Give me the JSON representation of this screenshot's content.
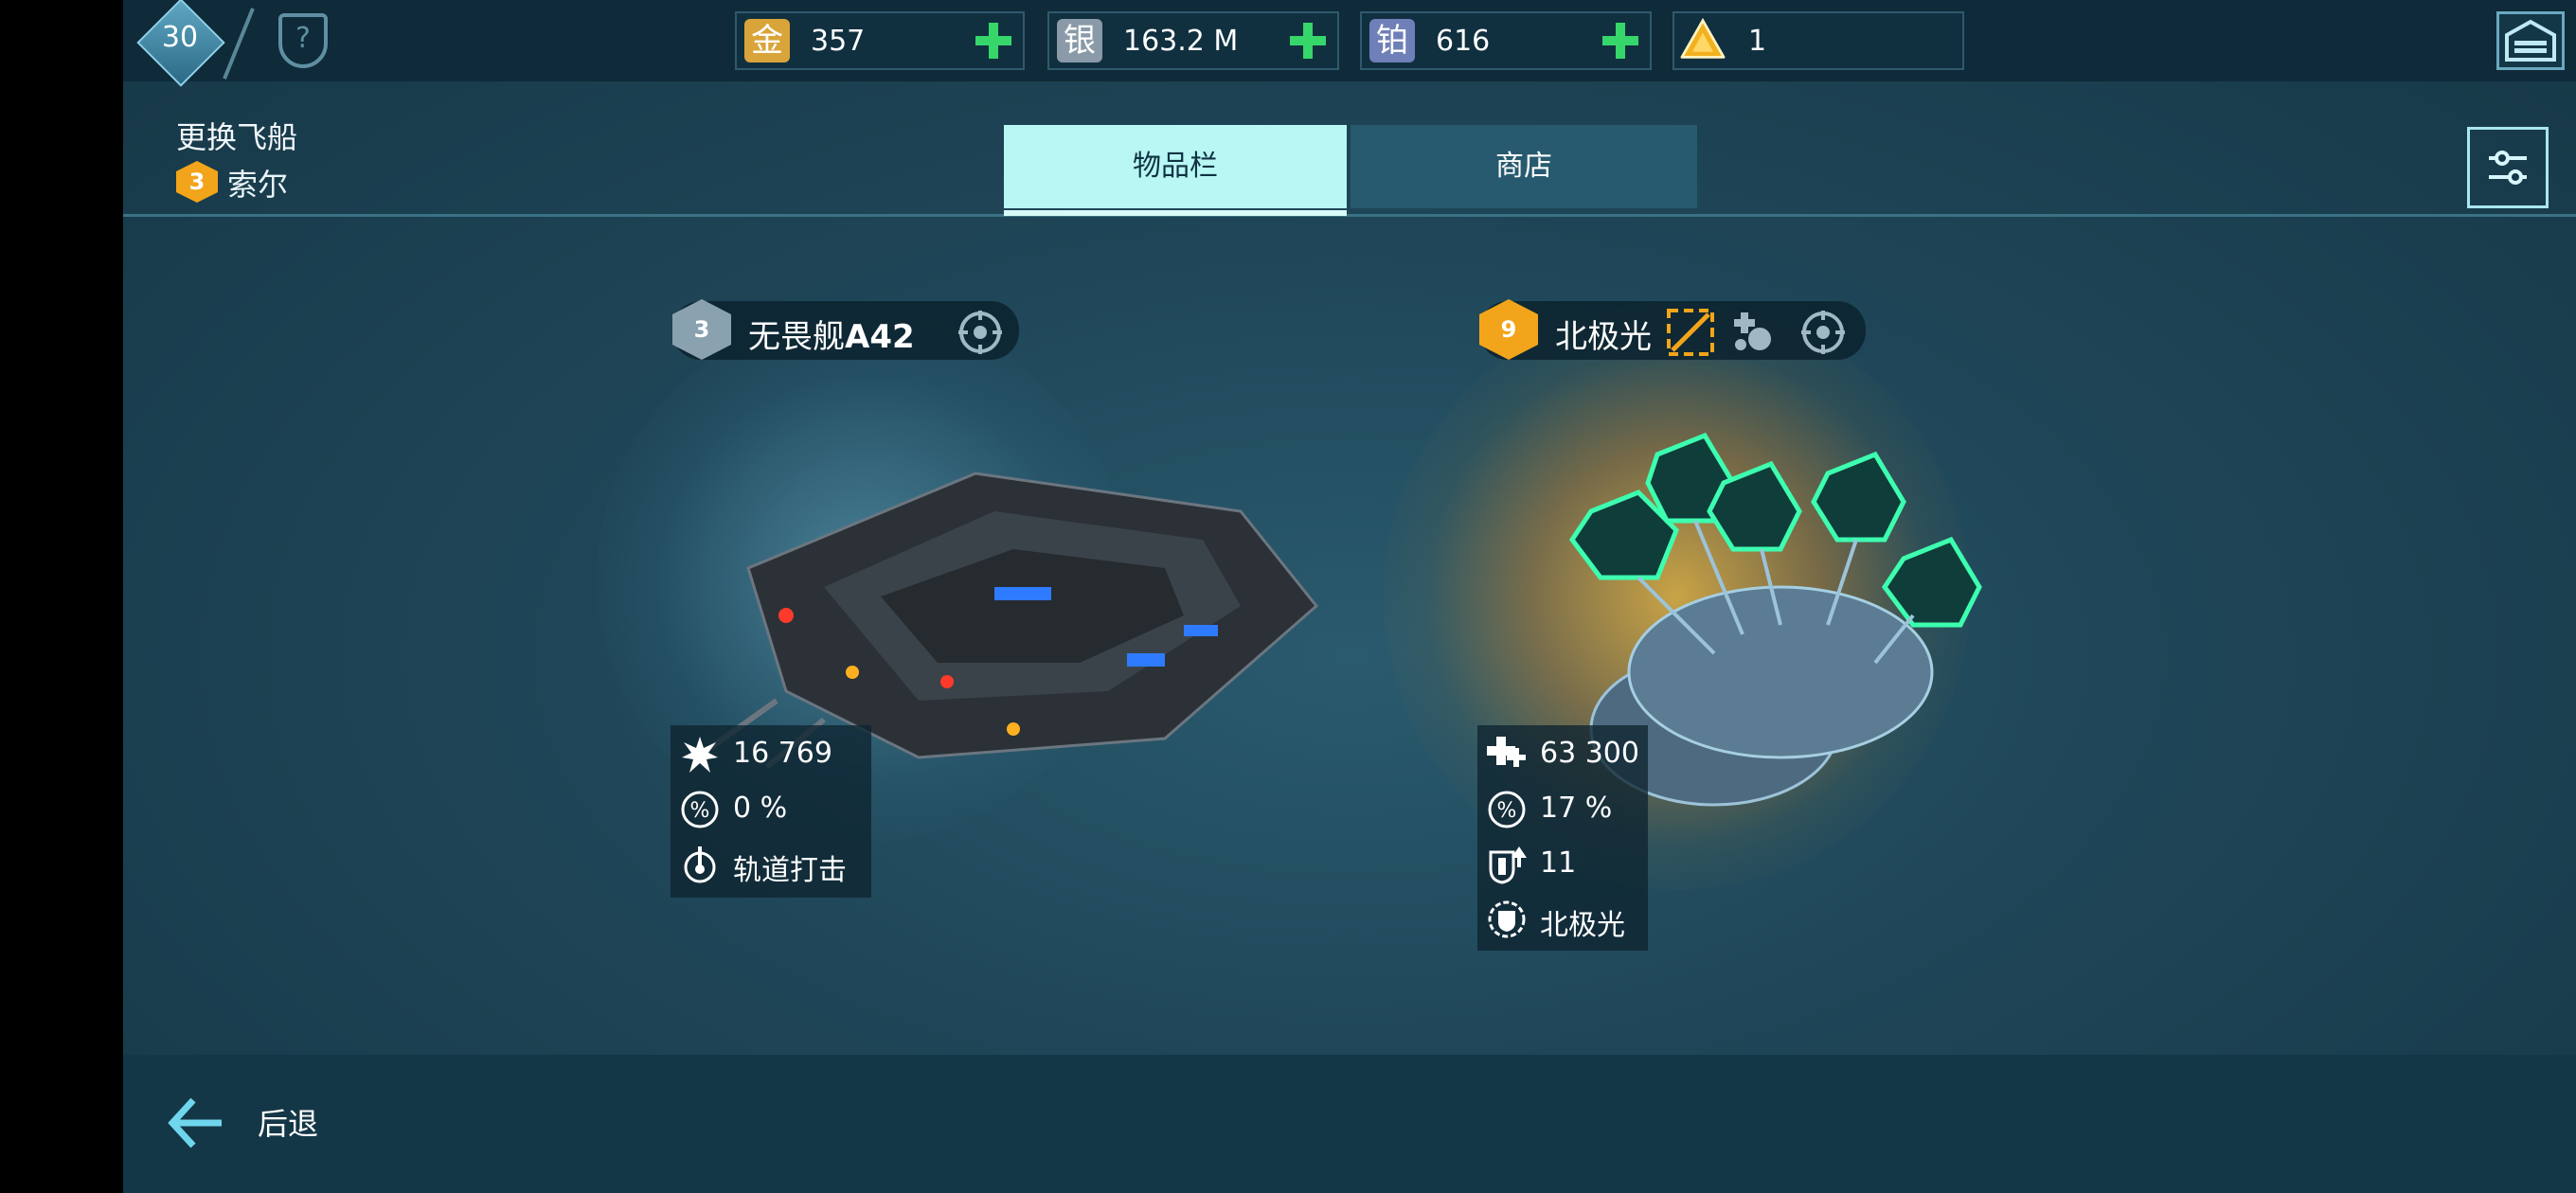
{
  "topbar": {
    "level": "30",
    "resources": [
      {
        "icon_glyph": "金",
        "value": "357",
        "color": "#d9a43a"
      },
      {
        "icon_glyph": "银",
        "value": "163.2 M",
        "color": "#8a9aa8"
      },
      {
        "icon_glyph": "铂",
        "value": "616",
        "color": "#6f7fb8"
      },
      {
        "icon_glyph": "",
        "value": "1",
        "color": "#f2b11e"
      }
    ]
  },
  "header": {
    "change_ship_label": "更换飞船",
    "current_rank": "3",
    "current_ship": "索尔"
  },
  "tabs": {
    "inventory": "物品栏",
    "shop": "商店"
  },
  "ships": [
    {
      "rank": "3",
      "name_prefix": "无畏舰",
      "name_suffix": "A42",
      "stats": [
        "16 769",
        "0 %",
        "轨道打击"
      ]
    },
    {
      "rank": "9",
      "name": "北极光",
      "stats": [
        "63 300",
        "17 %",
        "11",
        "北极光"
      ]
    }
  ],
  "footer": {
    "back_label": "后退"
  },
  "colors": {
    "accent_cyan": "#b8f7f4",
    "rank_gold": "#f2a51a",
    "rank_silver": "#8aa2b0",
    "plus_green": "#36d66b"
  }
}
